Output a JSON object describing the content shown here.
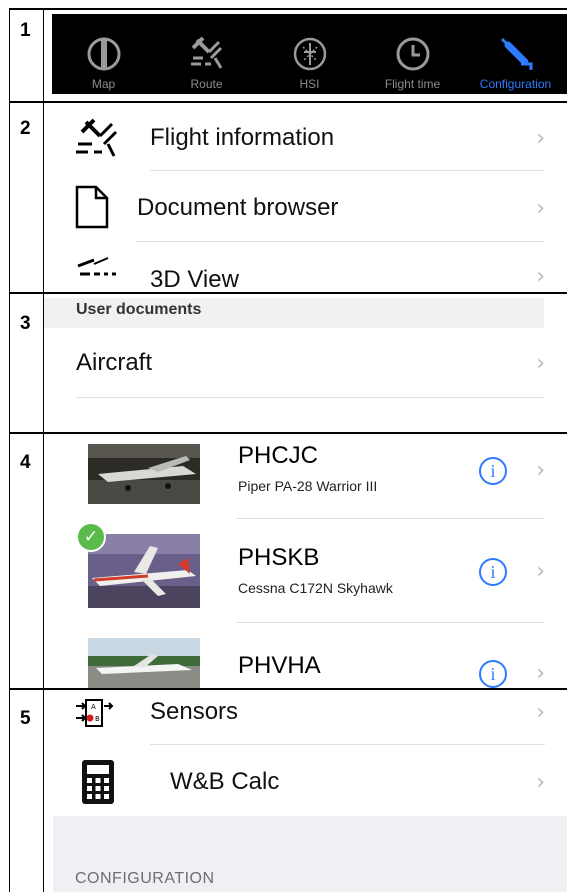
{
  "section_numbers": [
    "1",
    "2",
    "3",
    "4",
    "5"
  ],
  "tabbar": {
    "tabs": [
      {
        "label": "Map",
        "icon": "map-icon",
        "active": false
      },
      {
        "label": "Route",
        "icon": "route-icon",
        "active": false
      },
      {
        "label": "HSI",
        "icon": "hsi-icon",
        "active": false
      },
      {
        "label": "Flight time",
        "icon": "clock-icon",
        "active": false
      },
      {
        "label": "Configuration",
        "icon": "wrench-icon",
        "active": true
      }
    ],
    "active_color": "#2f7bff"
  },
  "menu": {
    "flight_information": "Flight information",
    "document_browser": "Document browser",
    "view_3d": "3D View",
    "chevron": "›"
  },
  "user_documents": {
    "header": "User documents",
    "aircraft": "Aircraft"
  },
  "aircraft_list": [
    {
      "registration": "PHCJC",
      "model": "Piper PA-28 Warrior III",
      "selected": false
    },
    {
      "registration": "PHSKB",
      "model": "Cessna C172N Skyhawk",
      "selected": true
    },
    {
      "registration": "PHVHA",
      "model": "",
      "selected": false
    }
  ],
  "info_glyph": "i",
  "check_glyph": "✓",
  "tools": {
    "sensors": "Sensors",
    "wb_calc": "W&B Calc"
  },
  "footer": {
    "label": "CONFIGURATION"
  }
}
